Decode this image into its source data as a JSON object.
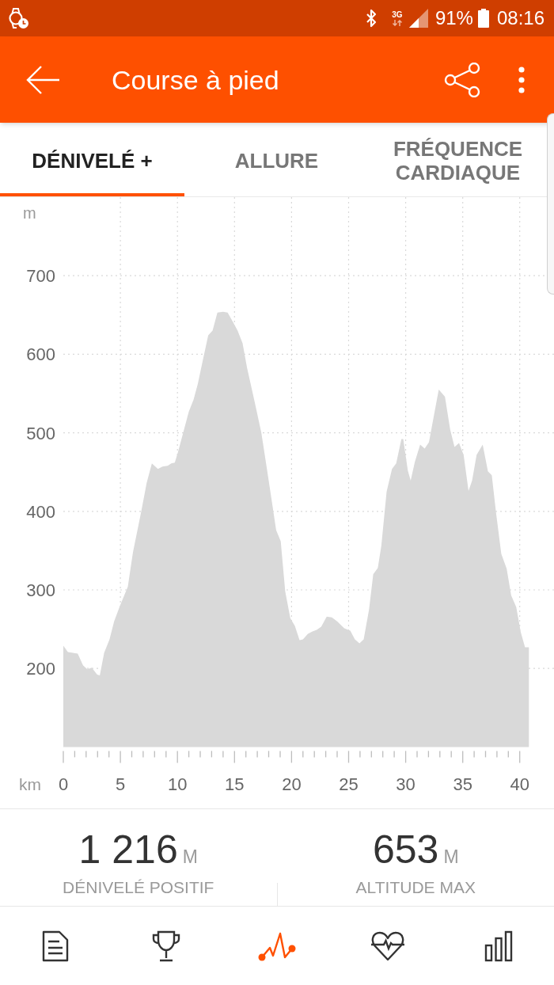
{
  "status_bar": {
    "network_type": "3G",
    "battery": "91%",
    "time": "08:16"
  },
  "app_bar": {
    "title": "Course à pied"
  },
  "tabs": [
    {
      "label": "DÉNIVELÉ +",
      "selected": true
    },
    {
      "label": "ALLURE",
      "selected": false
    },
    {
      "label": "FRÉQUENCE CARDIAQUE",
      "selected": false
    }
  ],
  "chart": {
    "chart_data": {
      "type": "area",
      "xlabel": "km",
      "ylabel": "m",
      "x": [
        0,
        0.4,
        1.26,
        1.73,
        2.1,
        2.5,
        2.97,
        3.2,
        3.58,
        4.05,
        4.45,
        4.97,
        5.65,
        6.1,
        6.83,
        7.3,
        7.76,
        8.29,
        8.69,
        9.15,
        9.46,
        9.77,
        10.08,
        10.54,
        11,
        11.41,
        11.78,
        12.25,
        12.7,
        13.08,
        13.5,
        14,
        14.4,
        14.87,
        15.27,
        15.71,
        16.1,
        16.73,
        17.35,
        17.81,
        18.28,
        18.65,
        19.05,
        19.45,
        19.89,
        20.29,
        20.7,
        21,
        21.43,
        21.83,
        22.2,
        22.6,
        23.08,
        23.53,
        24,
        24.62,
        25.15,
        25.55,
        25.95,
        26.32,
        26.79,
        27.16,
        27.56,
        27.87,
        28.33,
        28.8,
        29.17,
        29.63,
        29.79,
        30.19,
        30.44,
        30.81,
        31.27,
        31.67,
        32.04,
        32.45,
        32.9,
        33.44,
        33.9,
        34.28,
        34.68,
        35.08,
        35.51,
        35.82,
        36.22,
        36.75,
        37.21,
        37.55,
        37.92,
        38.38,
        38.85,
        39.25,
        39.69,
        40.09,
        40.46,
        40.8
      ],
      "values": [
        229,
        221,
        219,
        204,
        199,
        201,
        192,
        191,
        220,
        237,
        260,
        280,
        304,
        348,
        400,
        436,
        461,
        454,
        457,
        458,
        461,
        462,
        477,
        502,
        527,
        542,
        562,
        594,
        624,
        630,
        653,
        654,
        653,
        641,
        630,
        614,
        583,
        542,
        500,
        457,
        412,
        376,
        362,
        298,
        264,
        254,
        236,
        237,
        244,
        247,
        249,
        253,
        266,
        265,
        260,
        251,
        248,
        237,
        232,
        237,
        275,
        320,
        328,
        356,
        425,
        454,
        461,
        492,
        492,
        452,
        439,
        463,
        485,
        480,
        488,
        520,
        555,
        546,
        504,
        482,
        487,
        472,
        426,
        439,
        472,
        485,
        451,
        446,
        398,
        346,
        327,
        293,
        278,
        246,
        227,
        227
      ],
      "xlim": [
        0,
        43
      ],
      "ylim": [
        100,
        800
      ],
      "xticks": [
        0,
        5,
        10,
        15,
        20,
        25,
        30,
        35,
        40
      ],
      "yticks": [
        200,
        300,
        400,
        500,
        600,
        700
      ],
      "grid": true
    }
  },
  "stats": [
    {
      "value": "1 216",
      "unit": "M",
      "label": "DÉNIVELÉ POSITIF"
    },
    {
      "value": "653",
      "unit": "M",
      "label": "ALTITUDE MAX"
    }
  ],
  "bottom_nav": [
    {
      "kind": "document",
      "selected": false
    },
    {
      "kind": "trophy",
      "selected": false
    },
    {
      "kind": "profile",
      "selected": true
    },
    {
      "kind": "heart",
      "selected": false
    },
    {
      "kind": "bars",
      "selected": false
    }
  ]
}
